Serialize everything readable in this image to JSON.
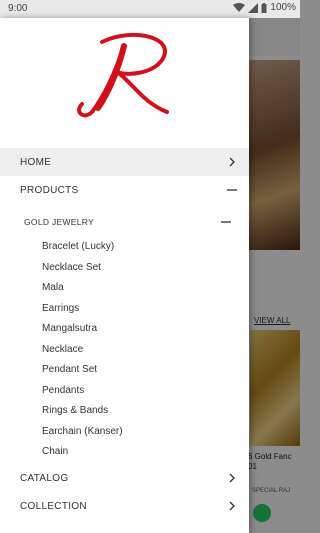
{
  "status_bar": {
    "time": "9:00",
    "battery": "100%"
  },
  "background": {
    "view_all": "VIEW ALL",
    "product_caption_line1": "6 Gold Fanc",
    "product_caption_line2": "01",
    "small_caption": "SPECIAL RAJ"
  },
  "drawer": {
    "logo_letter": "R",
    "brand_color": "#d0101a",
    "menu": {
      "home": "HOME",
      "products": "PRODUCTS",
      "gold_jewelry": "GOLD JEWELRY",
      "catalog": "CATALOG",
      "collection": "COLLECTION"
    },
    "gold_items": [
      "Bracelet (Lucky)",
      "Necklace Set",
      "Mala",
      "Earrings",
      "Mangalsutra",
      "Necklace",
      "Pendant Set",
      "Pendants",
      "Rings & Bands",
      "Earchain (Kanser)",
      "Chain"
    ]
  }
}
